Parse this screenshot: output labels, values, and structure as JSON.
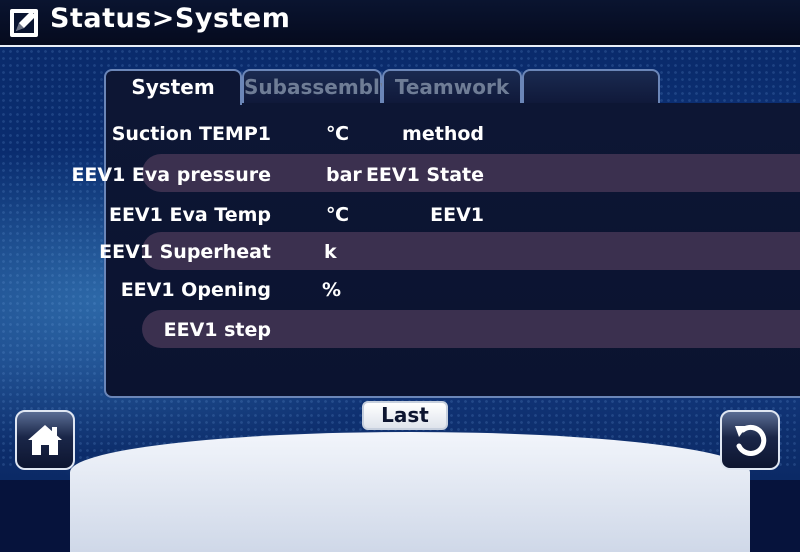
{
  "header": {
    "title": "Status>System",
    "icon": "edit-square-icon"
  },
  "tabs": [
    {
      "label": "System",
      "active": true
    },
    {
      "label": "Subassembly",
      "active": false
    },
    {
      "label": "Teamwork",
      "active": false
    },
    {
      "label": "",
      "active": false
    }
  ],
  "rows": [
    {
      "label": "Suction TEMP1",
      "unit": "℃",
      "extra": "method"
    },
    {
      "label": "EEV1 Eva pressure",
      "unit": "bar",
      "extra": "EEV1 State"
    },
    {
      "label": "EEV1 Eva Temp",
      "unit": "℃",
      "extra": "EEV1"
    },
    {
      "label": "EEV1 Superheat",
      "unit": "k",
      "extra": ""
    },
    {
      "label": "EEV1 Opening",
      "unit": "%",
      "extra": ""
    },
    {
      "label": "EEV1 step",
      "unit": "",
      "extra": ""
    }
  ],
  "buttons": {
    "last_label": "Last",
    "home_icon": "home-icon",
    "back_icon": "back-arrow-icon"
  },
  "colors": {
    "row_band": "#3b304f",
    "panel": "#0d1634",
    "header": "#050a1e",
    "tab_border": "#6b86b8"
  }
}
